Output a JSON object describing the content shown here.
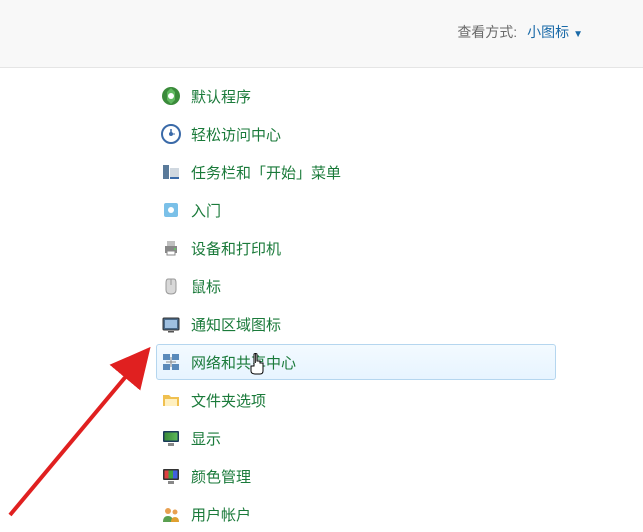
{
  "header": {
    "view_mode_label": "查看方式:",
    "view_mode_value": "小图标"
  },
  "items": [
    {
      "label": "默认程序",
      "icon": "shield"
    },
    {
      "label": "轻松访问中心",
      "icon": "clock"
    },
    {
      "label": "任务栏和「开始」菜单",
      "icon": "taskbar"
    },
    {
      "label": "入门",
      "icon": "getstarted"
    },
    {
      "label": "设备和打印机",
      "icon": "printer"
    },
    {
      "label": "鼠标",
      "icon": "mouse"
    },
    {
      "label": "通知区域图标",
      "icon": "notify"
    },
    {
      "label": "网络和共享中心",
      "icon": "network",
      "highlighted": true
    },
    {
      "label": "文件夹选项",
      "icon": "folder"
    },
    {
      "label": "显示",
      "icon": "display"
    },
    {
      "label": "颜色管理",
      "icon": "color"
    },
    {
      "label": "用户帐户",
      "icon": "users"
    }
  ]
}
